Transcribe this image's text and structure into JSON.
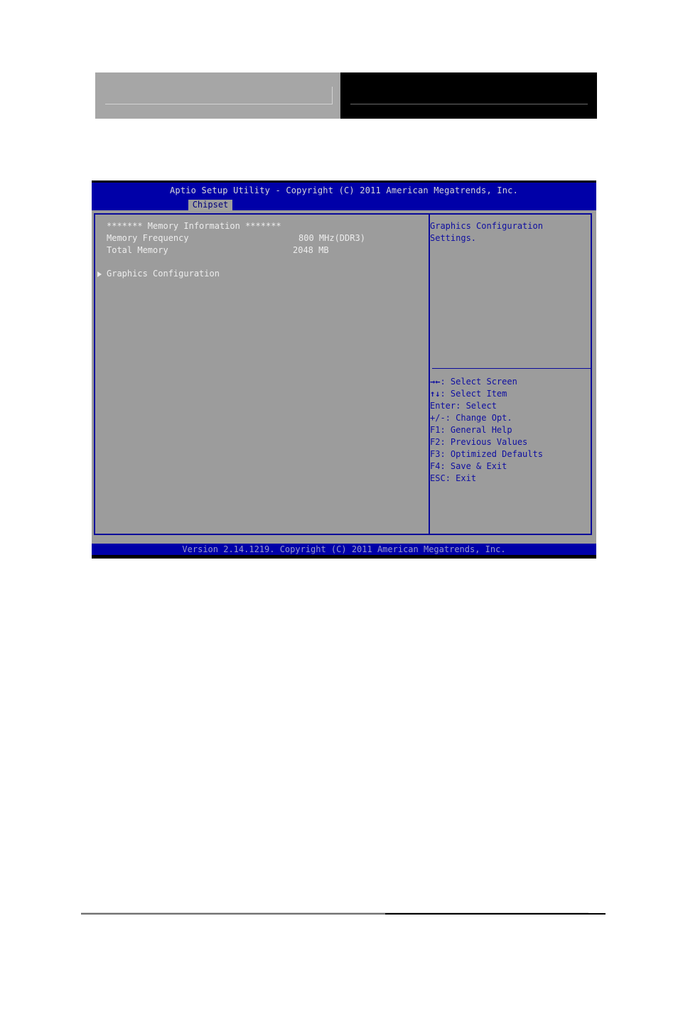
{
  "bios": {
    "title": "Aptio Setup Utility - Copyright (C) 2011 American Megatrends, Inc.",
    "active_tab": "Chipset",
    "main": {
      "section_header": "******* Memory Information *******",
      "rows": [
        {
          "label": "Memory Frequency",
          "value": "800 MHz(DDR3)"
        },
        {
          "label": "Total Memory",
          "value": "2048 MB"
        }
      ],
      "submenu": {
        "label": "Graphics Configuration",
        "icon": "triangle-right-icon"
      }
    },
    "help": {
      "description": [
        "Graphics Configuration",
        "Settings."
      ],
      "keys": [
        {
          "key": "→←",
          "action": "Select Screen"
        },
        {
          "key": "↑↓",
          "action": "Select Item"
        },
        {
          "key": "Enter",
          "action": "Select"
        },
        {
          "key": "+/-",
          "action": "Change Opt."
        },
        {
          "key": "F1",
          "action": "General Help"
        },
        {
          "key": "F2",
          "action": "Previous Values"
        },
        {
          "key": "F3",
          "action": "Optimized Defaults"
        },
        {
          "key": "F4",
          "action": "Save & Exit"
        },
        {
          "key": "ESC",
          "action": "Exit"
        }
      ]
    },
    "footer": "Version 2.14.1219. Copyright (C) 2011 American Megatrends, Inc.",
    "colors": {
      "title_bar": "#0000a8",
      "body": "#9c9c9c",
      "frame": "#0a0a9a",
      "help_text": "#0e0ea0"
    }
  }
}
